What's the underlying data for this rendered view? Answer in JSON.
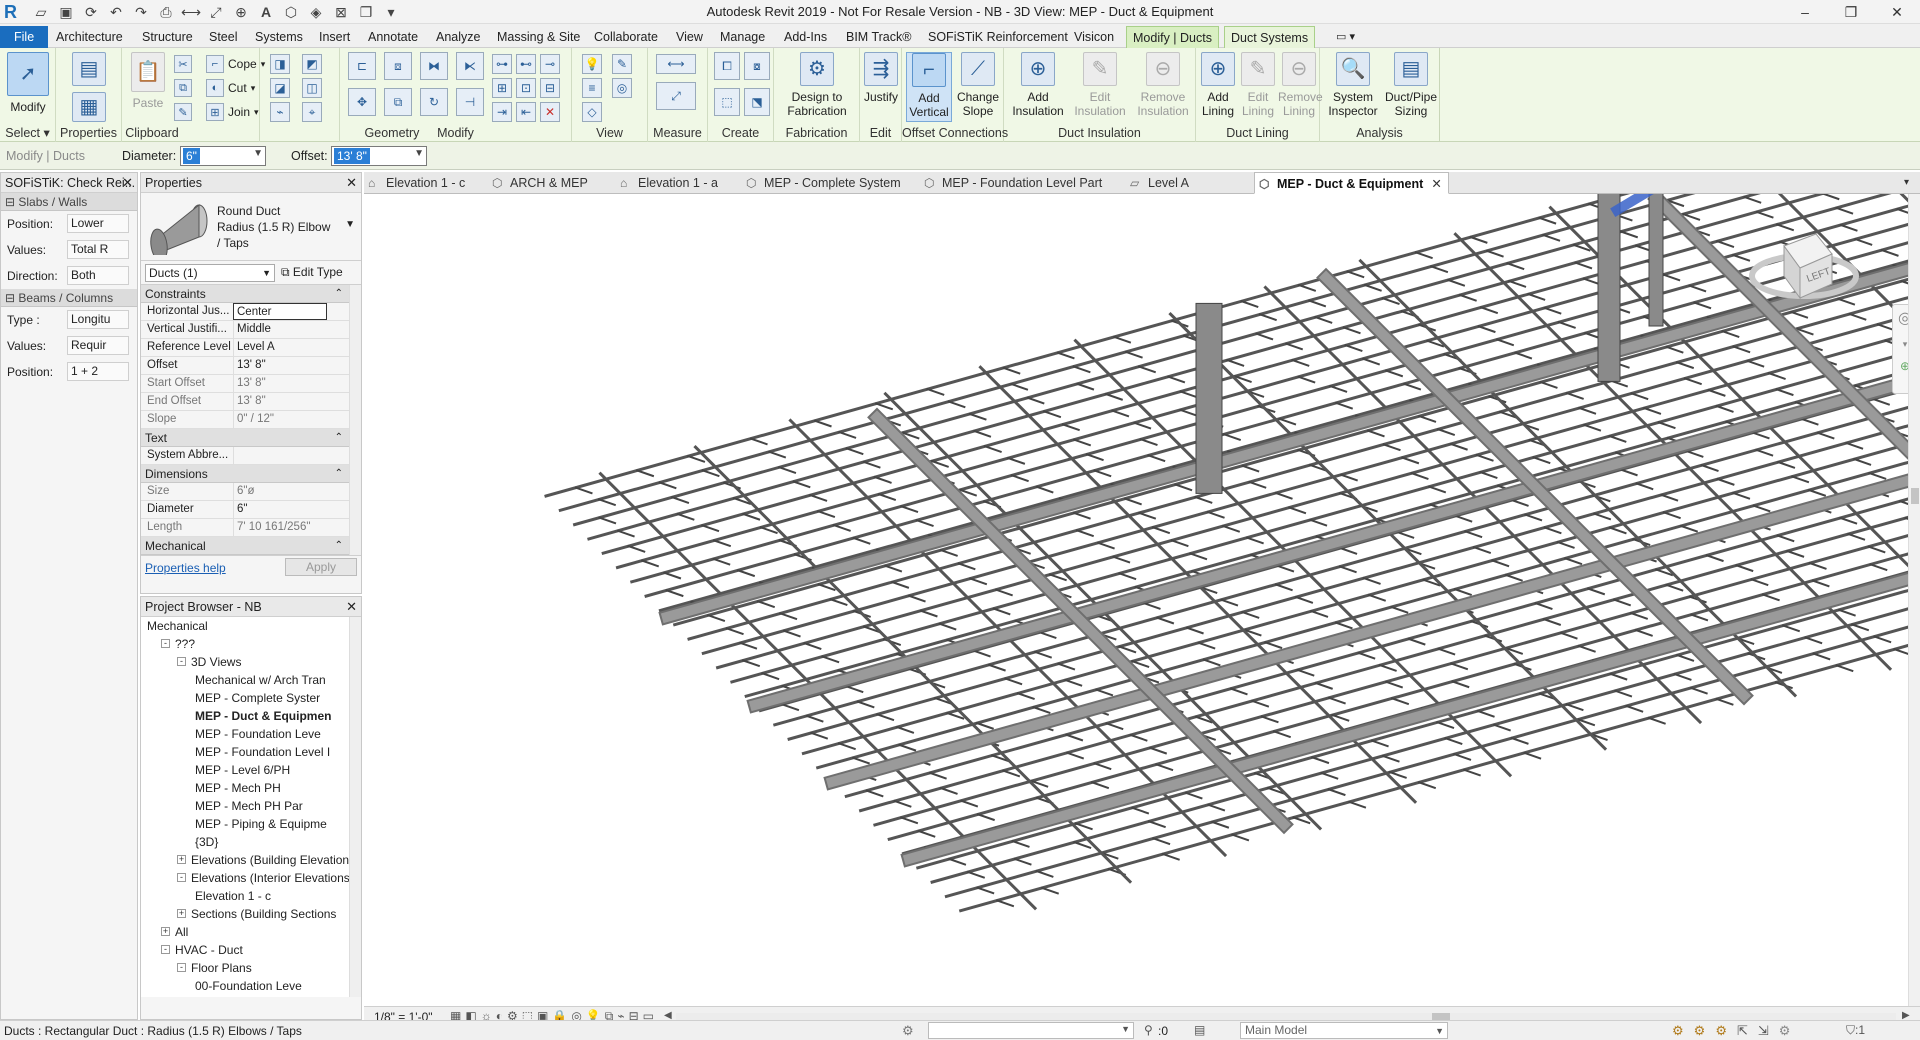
{
  "app": {
    "title": "Autodesk Revit 2019 - Not For Resale Version - NB - 3D View: MEP - Duct & Equipment",
    "logo_letter": "R"
  },
  "menu_tabs": [
    "File",
    "Architecture",
    "Structure",
    "Steel",
    "Systems",
    "Insert",
    "Annotate",
    "Analyze",
    "Massing & Site",
    "Collaborate",
    "View",
    "Manage",
    "Add-Ins",
    "BIM Track®",
    "SOFiSTiK Reinforcement",
    "Visicon",
    "Modify | Ducts",
    "Duct Systems"
  ],
  "ribbon": {
    "modify_label": "Modify",
    "properties_label": "Properties",
    "paste_label": "Paste",
    "cope_label": "Cope",
    "cut_label": "Cut",
    "join_label": "Join",
    "design_to_fab": "Design to Fabrication",
    "justify": "Justify",
    "add_vertical": "Add Vertical",
    "change_slope": "Change Slope",
    "add_insulation": "Add Insulation",
    "edit_insulation": "Edit Insulation",
    "remove_insulation": "Remove Insulation",
    "add_lining": "Add Lining",
    "edit_lining": "Edit Lining",
    "remove_lining": "Remove Lining",
    "system_inspector": "System Inspector",
    "duct_pipe_sizing": "Duct/Pipe Sizing",
    "panels": {
      "select": "Select",
      "properties": "Properties",
      "clipboard": "Clipboard",
      "geometry": "Geometry",
      "modify": "Modify",
      "view": "View",
      "measure": "Measure",
      "create": "Create",
      "fabrication": "Fabrication",
      "edit": "Edit",
      "offset_connections": "Offset Connections",
      "duct_insulation": "Duct Insulation",
      "duct_lining": "Duct Lining",
      "analysis": "Analysis"
    }
  },
  "options_bar": {
    "context": "Modify | Ducts",
    "diameter_label": "Diameter:",
    "diameter_value": "6\"",
    "offset_label": "Offset:",
    "offset_value": "13'  8\""
  },
  "view_tabs": [
    "Elevation 1 - c",
    "ARCH & MEP",
    "Elevation 1 - a",
    "MEP - Complete System",
    "MEP - Foundation Level Part",
    "Level A",
    "MEP - Duct & Equipment"
  ],
  "sofistik": {
    "title": "SOFiSTiK: Check Rei...",
    "slabs_header": "Slabs / Walls",
    "position_label": "Position:",
    "position_value": "Lower",
    "values_label": "Values:",
    "values_value": "Total R",
    "direction_label": "Direction:",
    "direction_value": "Both",
    "beams_header": "Beams / Columns",
    "type_label": "Type :",
    "type_value": "Longitu",
    "values2_label": "Values:",
    "values2_value": "Requir",
    "position2_label": "Position:",
    "position2_value": "1 + 2"
  },
  "properties": {
    "title": "Properties",
    "family": "Round Duct",
    "type": "Radius (1.5 R) Elbow / Taps",
    "selector": "Ducts (1)",
    "edit_type": "Edit Type",
    "sections": [
      {
        "name": "Constraints",
        "rows": [
          {
            "k": "Horizontal Jus...",
            "v": "Center",
            "grey": false
          },
          {
            "k": "Vertical Justifi...",
            "v": "Middle",
            "grey": false
          },
          {
            "k": "Reference Level",
            "v": "Level A",
            "grey": false
          },
          {
            "k": "Offset",
            "v": "13'  8\"",
            "grey": false
          },
          {
            "k": "Start Offset",
            "v": "13'  8\"",
            "grey": true
          },
          {
            "k": "End Offset",
            "v": "13'  8\"",
            "grey": true
          },
          {
            "k": "Slope",
            "v": "0\" / 12\"",
            "grey": true
          }
        ]
      },
      {
        "name": "Text",
        "rows": [
          {
            "k": "System Abbre...",
            "v": "",
            "grey": false
          }
        ]
      },
      {
        "name": "Dimensions",
        "rows": [
          {
            "k": "Size",
            "v": "6\"ø",
            "grey": true
          },
          {
            "k": "Diameter",
            "v": "6\"",
            "grey": false
          },
          {
            "k": "Length",
            "v": "7'  10 161/256\"",
            "grey": true
          }
        ]
      },
      {
        "name": "Mechanical",
        "rows": []
      }
    ],
    "help": "Properties help",
    "apply": "Apply"
  },
  "browser": {
    "title": "Project Browser - NB",
    "items": [
      {
        "t": "Mechanical",
        "lvl": 0,
        "tog": "",
        "bold": false
      },
      {
        "t": "???",
        "lvl": 1,
        "tog": "-",
        "bold": false
      },
      {
        "t": "3D Views",
        "lvl": 2,
        "tog": "-",
        "bold": false
      },
      {
        "t": "Mechanical w/ Arch Tran",
        "lvl": 3,
        "tog": "",
        "bold": false
      },
      {
        "t": "MEP - Complete Syster",
        "lvl": 3,
        "tog": "",
        "bold": false
      },
      {
        "t": "MEP - Duct & Equipmen",
        "lvl": 3,
        "tog": "",
        "bold": true
      },
      {
        "t": "MEP - Foundation Leve",
        "lvl": 3,
        "tog": "",
        "bold": false
      },
      {
        "t": "MEP - Foundation Level I",
        "lvl": 3,
        "tog": "",
        "bold": false
      },
      {
        "t": "MEP - Level 6/PH",
        "lvl": 3,
        "tog": "",
        "bold": false
      },
      {
        "t": "MEP - Mech PH",
        "lvl": 3,
        "tog": "",
        "bold": false
      },
      {
        "t": "MEP - Mech PH Par",
        "lvl": 3,
        "tog": "",
        "bold": false
      },
      {
        "t": "MEP - Piping & Equipme",
        "lvl": 3,
        "tog": "",
        "bold": false
      },
      {
        "t": "{3D}",
        "lvl": 3,
        "tog": "",
        "bold": false
      },
      {
        "t": "Elevations (Building Elevation",
        "lvl": 2,
        "tog": "+",
        "bold": false
      },
      {
        "t": "Elevations (Interior Elevations",
        "lvl": 2,
        "tog": "-",
        "bold": false
      },
      {
        "t": "Elevation 1 - c",
        "lvl": 3,
        "tog": "",
        "bold": false
      },
      {
        "t": "Sections (Building Sections",
        "lvl": 2,
        "tog": "+",
        "bold": false
      },
      {
        "t": "All",
        "lvl": 1,
        "tog": "+",
        "bold": false
      },
      {
        "t": "HVAC - Duct",
        "lvl": 1,
        "tog": "-",
        "bold": false
      },
      {
        "t": "Floor Plans",
        "lvl": 2,
        "tog": "-",
        "bold": false
      },
      {
        "t": "00-Foundation Leve",
        "lvl": 3,
        "tog": "",
        "bold": false
      }
    ]
  },
  "viewcube": {
    "face": "LEFT"
  },
  "viewctrl": {
    "scale": "1/8\" = 1'-0\""
  },
  "status": {
    "text": "Ducts : Rectangular Duct : Radius (1.5 R) Elbows / Taps",
    "count": ":0",
    "model": "Main Model",
    "filter": ":1"
  },
  "colors": {
    "accent": "#1a6dbf",
    "ribbon_bg": "#f0f8e6",
    "context_tab": "#d9efc2",
    "duct": "#8c8c8c",
    "selected_duct": "#3a63c9"
  }
}
